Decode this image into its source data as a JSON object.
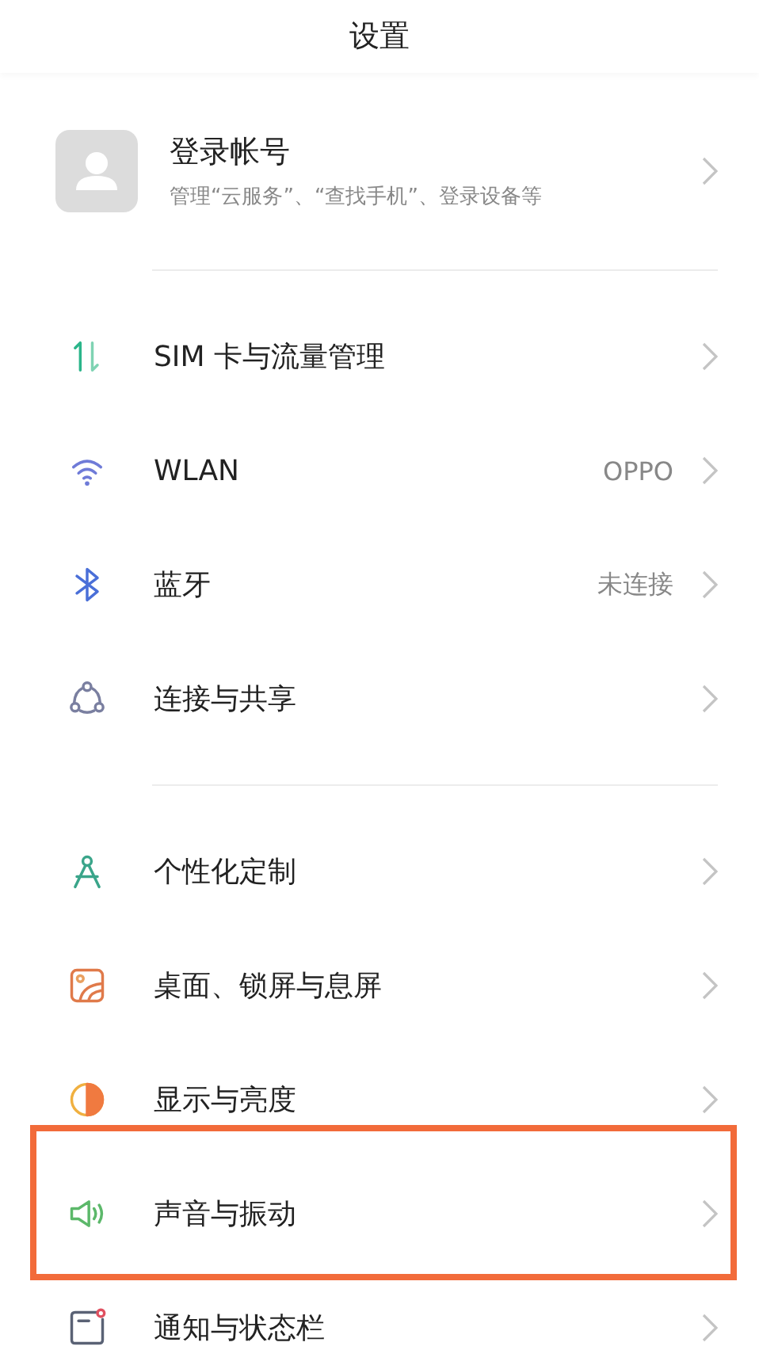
{
  "title": "设置",
  "account": {
    "name": "登录帐号",
    "subtitle": "管理“云服务”、“查找手机”、登录设备等"
  },
  "sections": [
    {
      "items": [
        {
          "kind": "sim",
          "label": "SIM 卡与流量管理",
          "highlighted": false
        },
        {
          "kind": "wifi",
          "label": "WLAN",
          "value": "OPPO",
          "highlighted": false
        },
        {
          "kind": "bluetooth",
          "label": "蓝牙",
          "value": "未连接",
          "highlighted": false
        },
        {
          "kind": "share",
          "label": "连接与共享",
          "highlighted": false
        }
      ]
    },
    {
      "items": [
        {
          "kind": "compass",
          "label": "个性化定制",
          "highlighted": false
        },
        {
          "kind": "wallpaper",
          "label": "桌面、锁屏与息屏",
          "highlighted": false
        },
        {
          "kind": "display",
          "label": "显示与亮度",
          "highlighted": false
        },
        {
          "kind": "sound",
          "label": "声音与振动",
          "highlighted": true
        },
        {
          "kind": "notify",
          "label": "通知与状态栏",
          "highlighted": false
        }
      ]
    }
  ]
}
